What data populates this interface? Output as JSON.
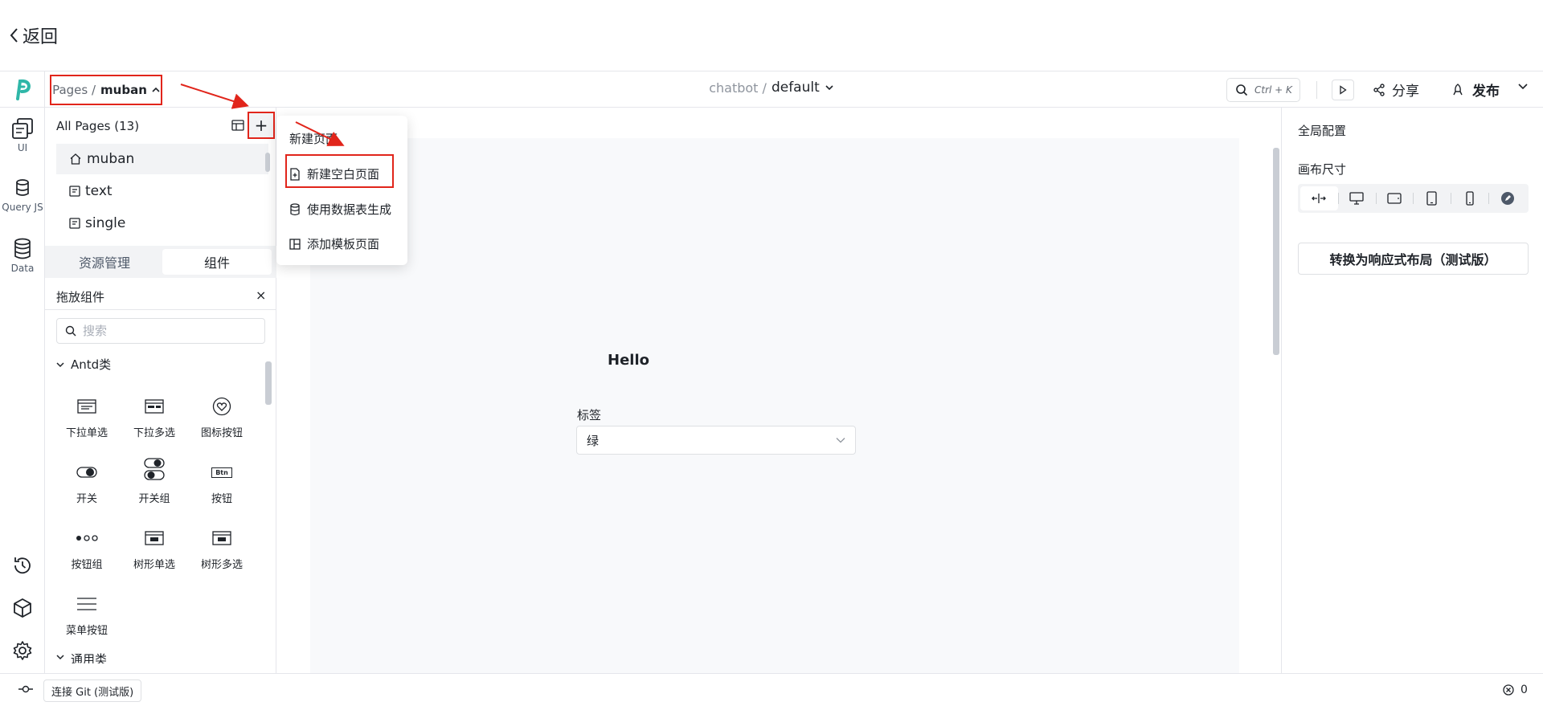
{
  "back": {
    "label": "返回"
  },
  "header": {
    "crumb_root": "Pages /",
    "crumb_page": "muban",
    "project_prefix": "chatbot /",
    "project_name": "default",
    "search_shortcut": "Ctrl + K",
    "share_label": "分享",
    "publish_label": "发布"
  },
  "rail": {
    "items": [
      {
        "label": "UI",
        "icon": "ui-pages-icon"
      },
      {
        "label": "Query JS",
        "icon": "database-icon"
      },
      {
        "label": "Data",
        "icon": "data-icon"
      }
    ],
    "bottom_icons": [
      "history-icon",
      "package-icon",
      "settings-icon"
    ]
  },
  "pages_panel": {
    "title": "All Pages (13)",
    "add_label": "+",
    "pages": [
      {
        "name": "muban",
        "icon": "home-icon"
      },
      {
        "name": "text",
        "icon": "page-icon"
      },
      {
        "name": "single",
        "icon": "page-icon"
      }
    ],
    "tabs": [
      "资源管理",
      "组件"
    ],
    "active_tab": "组件"
  },
  "components": {
    "title": "拖放组件",
    "close": "×",
    "search_placeholder": "搜索",
    "groups": [
      {
        "name": "Antd类",
        "items": [
          "下拉单选",
          "下拉多选",
          "图标按钮",
          "开关",
          "开关组",
          "按钮",
          "按钮组",
          "树形单选",
          "树形多选",
          "菜单按钮"
        ]
      },
      {
        "name": "通用类",
        "items": []
      }
    ],
    "btn_icon_text": "Btn"
  },
  "new_page_menu": {
    "title": "新建页面",
    "items": [
      {
        "label": "新建空白页面",
        "icon": "blank-page-icon"
      },
      {
        "label": "使用数据表生成",
        "icon": "database-icon"
      },
      {
        "label": "添加模板页面",
        "icon": "template-icon"
      }
    ]
  },
  "canvas": {
    "hello": "Hello",
    "tag_label": "标签",
    "tag_value": "绿"
  },
  "right_panel": {
    "global_config": "全局配置",
    "canvas_size": "画布尺寸",
    "size_options": [
      "auto-width-icon",
      "desktop-icon",
      "tablet-landscape-icon",
      "tablet-portrait-icon",
      "mobile-icon",
      "custom-edit-icon"
    ],
    "responsive_btn": "转换为响应式布局（测试版）"
  },
  "footer": {
    "git_label": "连接 Git (测试版)",
    "error_count": "0"
  },
  "colors": {
    "brand": "#2fb7a8",
    "annotation": "#e1251b"
  }
}
